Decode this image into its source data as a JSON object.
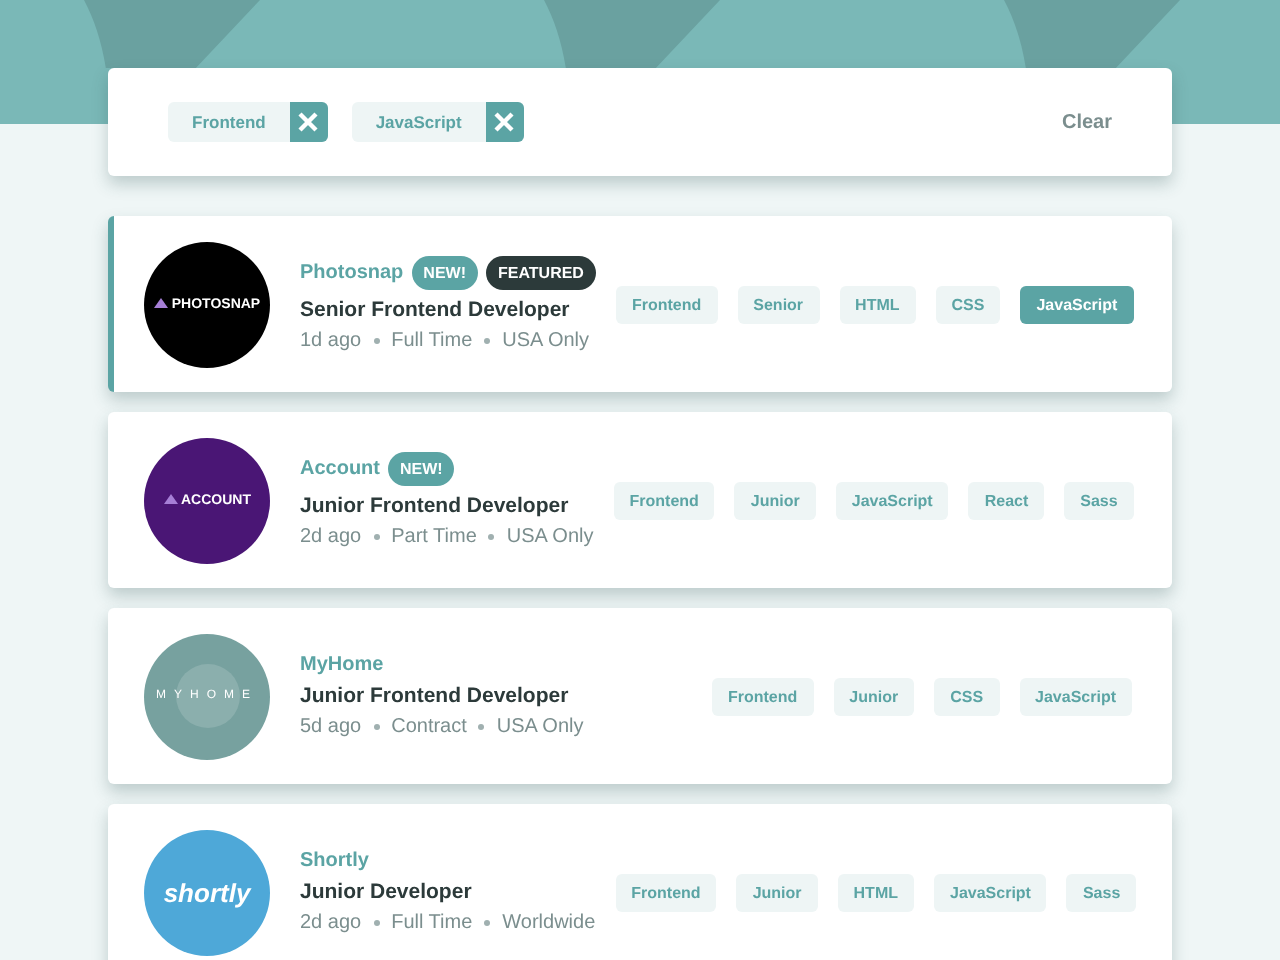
{
  "filters": {
    "tags": [
      {
        "label": "Frontend"
      },
      {
        "label": "JavaScript"
      }
    ],
    "clear": "Clear"
  },
  "jobs": [
    {
      "company": "Photosnap",
      "featured": true,
      "badges": [
        {
          "label": "NEW!",
          "kind": "new"
        },
        {
          "label": "FEATURED",
          "kind": "featured"
        }
      ],
      "logo": {
        "text": "PHOTOSNAP",
        "color": "#000000",
        "kind": "mark"
      },
      "position": "Senior Frontend Developer",
      "meta": [
        "1d ago",
        "Full Time",
        "USA Only"
      ],
      "tags": [
        {
          "label": "Frontend",
          "selected": false
        },
        {
          "label": "Senior",
          "selected": false
        },
        {
          "label": "HTML",
          "selected": false
        },
        {
          "label": "CSS",
          "selected": false
        },
        {
          "label": "JavaScript",
          "selected": true
        }
      ]
    },
    {
      "company": "Account",
      "featured": false,
      "badges": [
        {
          "label": "NEW!",
          "kind": "new"
        }
      ],
      "logo": {
        "text": "ACCOUNT",
        "color": "#4a1675",
        "kind": "mark"
      },
      "position": "Junior Frontend Developer",
      "meta": [
        "2d ago",
        "Part Time",
        "USA Only"
      ],
      "tags": [
        {
          "label": "Frontend",
          "selected": false
        },
        {
          "label": "Junior",
          "selected": false
        },
        {
          "label": "JavaScript",
          "selected": false
        },
        {
          "label": "React",
          "selected": false
        },
        {
          "label": "Sass",
          "selected": false
        }
      ]
    },
    {
      "company": "MyHome",
      "featured": false,
      "logo": {
        "text": "MYHOME",
        "color": "#77a19f",
        "kind": "spaced"
      },
      "position": "Junior Frontend Developer",
      "meta": [
        "5d ago",
        "Contract",
        "USA Only"
      ],
      "tags": [
        {
          "label": "Frontend",
          "selected": false
        },
        {
          "label": "Junior",
          "selected": false
        },
        {
          "label": "CSS",
          "selected": false
        },
        {
          "label": "JavaScript",
          "selected": false
        }
      ]
    },
    {
      "company": "Shortly",
      "featured": false,
      "logo": {
        "text": "shortly",
        "color": "#4ea8d8",
        "kind": "script"
      },
      "position": "Junior Developer",
      "meta": [
        "2d ago",
        "Full Time",
        "Worldwide"
      ],
      "tags": [
        {
          "label": "Frontend",
          "selected": false
        },
        {
          "label": "Junior",
          "selected": false
        },
        {
          "label": "HTML",
          "selected": false
        },
        {
          "label": "JavaScript",
          "selected": false
        },
        {
          "label": "Sass",
          "selected": false
        }
      ]
    }
  ]
}
